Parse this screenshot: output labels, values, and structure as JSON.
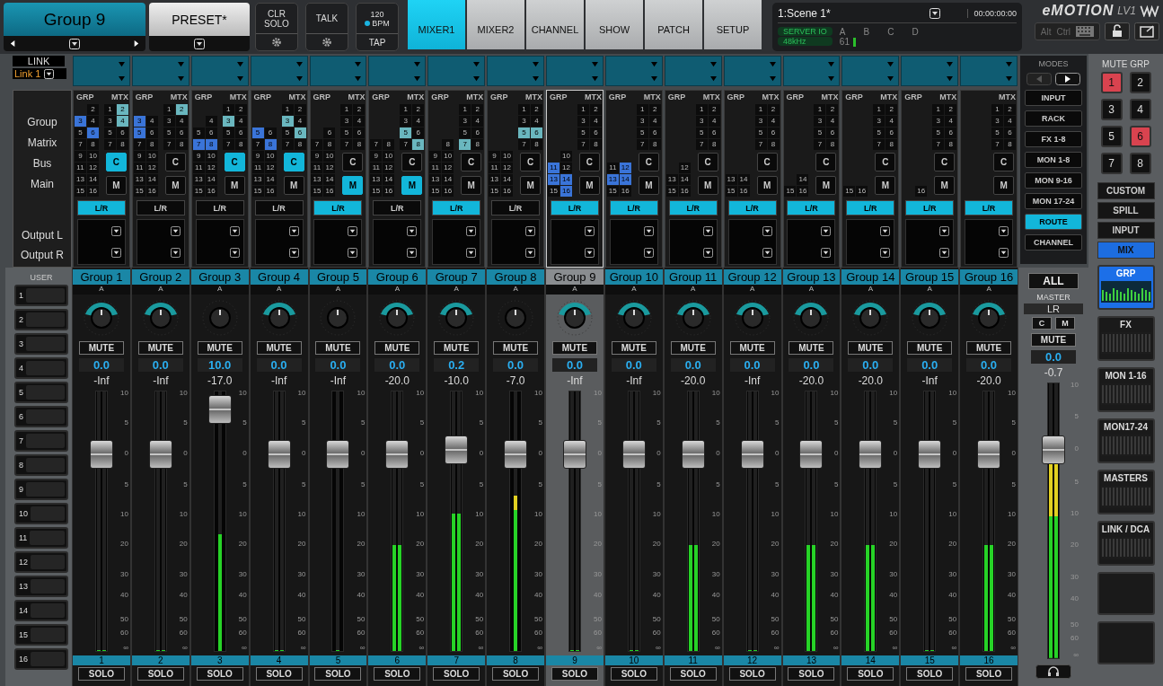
{
  "header": {
    "title": "Group 9",
    "preset": "PRESET*",
    "clr_solo": "CLR SOLO",
    "talk": "TALK",
    "bpm_value": "120",
    "bpm_label": "BPM",
    "tap": "TAP"
  },
  "tabs": [
    {
      "label": "MIXER1",
      "selected": true
    },
    {
      "label": "MIXER2",
      "selected": false
    },
    {
      "label": "CHANNEL",
      "selected": false
    },
    {
      "label": "SHOW",
      "selected": false
    },
    {
      "label": "PATCH",
      "selected": false
    },
    {
      "label": "SETUP",
      "selected": false
    }
  ],
  "scene": {
    "name": "1:Scene 1*",
    "timecode": "00:00:00:00",
    "server": "SERVER IO",
    "rate": "48kHz",
    "slots": [
      "A",
      "B",
      "C",
      "D"
    ],
    "reading": "61"
  },
  "logo": {
    "brand": "eMOTION",
    "model": "LV1"
  },
  "keys": [
    "Alt",
    "Ctrl"
  ],
  "link": {
    "title": "LINK",
    "value": "Link 1"
  },
  "route_labels": [
    "Group",
    "Matrix",
    "Bus",
    "Main",
    "Output L",
    "Output R"
  ],
  "user": {
    "title": "USER",
    "buttons": [
      "1",
      "2",
      "3",
      "4",
      "5",
      "6",
      "7",
      "8",
      "9",
      "10",
      "11",
      "12",
      "13",
      "14",
      "15",
      "16"
    ]
  },
  "channels": [
    {
      "name": "Group 1",
      "selected": false,
      "grp_header": "GRP",
      "mtx_header": "MTX",
      "grp": [
        {
          "label": "2",
          "selected": false
        },
        {
          "label": "3",
          "selected": true
        },
        {
          "label": "4",
          "selected": false
        },
        {
          "label": "5",
          "selected": false
        },
        {
          "label": "6",
          "selected": true
        },
        {
          "label": "7",
          "selected": false
        },
        {
          "label": "8",
          "selected": false
        },
        {
          "label": "9",
          "selected": false
        },
        {
          "label": "10",
          "selected": false
        },
        {
          "label": "11",
          "selected": false
        },
        {
          "label": "12",
          "selected": false
        },
        {
          "label": "13",
          "selected": false
        },
        {
          "label": "14",
          "selected": false
        },
        {
          "label": "15",
          "selected": false
        },
        {
          "label": "16",
          "selected": false
        }
      ],
      "mtx": [
        {
          "label": "1",
          "selected": false
        },
        {
          "label": "2",
          "selected": true
        },
        {
          "label": "3",
          "selected": false
        },
        {
          "label": "4",
          "selected": true
        },
        {
          "label": "5",
          "selected": false
        },
        {
          "label": "6",
          "selected": false
        },
        {
          "label": "7",
          "selected": false
        },
        {
          "label": "8",
          "selected": false
        }
      ],
      "c": {
        "label": "C",
        "on": true
      },
      "m": {
        "label": "M",
        "on": false
      },
      "lr": {
        "label": "L/R",
        "on": true
      },
      "insert": "A",
      "stereo": true,
      "mute": "MUTE",
      "value": "0.0",
      "reading": "-Inf",
      "scale": [
        "10",
        "5",
        "0",
        "5",
        "10",
        "20",
        "30",
        "40",
        "50",
        "60",
        "∞"
      ],
      "fader": {
        "level": 0.79
      },
      "meter": {
        "level": 0
      },
      "number": "1",
      "solo": "SOLO"
    },
    {
      "name": "Group 2",
      "selected": false,
      "grp_header": "GRP",
      "mtx_header": "MTX",
      "grp": [
        {
          "label": "3",
          "selected": true
        },
        {
          "label": "4",
          "selected": false
        },
        {
          "label": "5",
          "selected": true
        },
        {
          "label": "6",
          "selected": false
        },
        {
          "label": "7",
          "selected": false
        },
        {
          "label": "8",
          "selected": false
        },
        {
          "label": "9",
          "selected": false
        },
        {
          "label": "10",
          "selected": false
        },
        {
          "label": "11",
          "selected": false
        },
        {
          "label": "12",
          "selected": false
        },
        {
          "label": "13",
          "selected": false
        },
        {
          "label": "14",
          "selected": false
        },
        {
          "label": "15",
          "selected": false
        },
        {
          "label": "16",
          "selected": false
        }
      ],
      "mtx": [
        {
          "label": "1",
          "selected": false
        },
        {
          "label": "2",
          "selected": true
        },
        {
          "label": "3",
          "selected": false
        },
        {
          "label": "4",
          "selected": false
        },
        {
          "label": "5",
          "selected": false
        },
        {
          "label": "6",
          "selected": false
        },
        {
          "label": "7",
          "selected": false
        },
        {
          "label": "8",
          "selected": false
        }
      ],
      "c": {
        "label": "C",
        "on": false
      },
      "m": {
        "label": "M",
        "on": false
      },
      "lr": {
        "label": "L/R",
        "on": false
      },
      "insert": "A",
      "stereo": true,
      "mute": "MUTE",
      "value": "0.0",
      "reading": "-Inf",
      "scale": [
        "10",
        "5",
        "0",
        "5",
        "10",
        "20",
        "30",
        "40",
        "50",
        "60",
        "∞"
      ],
      "fader": {
        "level": 0.79
      },
      "meter": {
        "level": 0
      },
      "number": "2",
      "solo": "SOLO"
    },
    {
      "name": "Group 3",
      "selected": false,
      "grp_header": "GRP",
      "mtx_header": "MTX",
      "grp": [
        {
          "label": "4",
          "selected": false
        },
        {
          "label": "5",
          "selected": false
        },
        {
          "label": "6",
          "selected": false
        },
        {
          "label": "7",
          "selected": true
        },
        {
          "label": "8",
          "selected": true
        },
        {
          "label": "9",
          "selected": false
        },
        {
          "label": "10",
          "selected": false
        },
        {
          "label": "11",
          "selected": false
        },
        {
          "label": "12",
          "selected": false
        },
        {
          "label": "13",
          "selected": false
        },
        {
          "label": "14",
          "selected": false
        },
        {
          "label": "15",
          "selected": false
        },
        {
          "label": "16",
          "selected": false
        }
      ],
      "mtx": [
        {
          "label": "1",
          "selected": false
        },
        {
          "label": "2",
          "selected": false
        },
        {
          "label": "3",
          "selected": true
        },
        {
          "label": "4",
          "selected": false
        },
        {
          "label": "5",
          "selected": false
        },
        {
          "label": "6",
          "selected": false
        },
        {
          "label": "7",
          "selected": false
        },
        {
          "label": "8",
          "selected": false
        }
      ],
      "c": {
        "label": "C",
        "on": true
      },
      "m": {
        "label": "M",
        "on": false
      },
      "lr": {
        "label": "L/R",
        "on": false
      },
      "insert": "A",
      "stereo": false,
      "mute": "MUTE",
      "value": "10.0",
      "reading": "-17.0",
      "scale": [
        "10",
        "5",
        "0",
        "5",
        "10",
        "20",
        "30",
        "40",
        "50",
        "60",
        "∞"
      ],
      "fader": {
        "level": 0.98
      },
      "meter": {
        "level": 0.45
      },
      "number": "3",
      "solo": "SOLO"
    },
    {
      "name": "Group 4",
      "selected": false,
      "grp_header": "GRP",
      "mtx_header": "MTX",
      "grp": [
        {
          "label": "5",
          "selected": true
        },
        {
          "label": "6",
          "selected": false
        },
        {
          "label": "7",
          "selected": false
        },
        {
          "label": "8",
          "selected": true
        },
        {
          "label": "9",
          "selected": false
        },
        {
          "label": "10",
          "selected": false
        },
        {
          "label": "11",
          "selected": false
        },
        {
          "label": "12",
          "selected": false
        },
        {
          "label": "13",
          "selected": false
        },
        {
          "label": "14",
          "selected": false
        },
        {
          "label": "15",
          "selected": false
        },
        {
          "label": "16",
          "selected": false
        }
      ],
      "mtx": [
        {
          "label": "1",
          "selected": false
        },
        {
          "label": "2",
          "selected": false
        },
        {
          "label": "3",
          "selected": true
        },
        {
          "label": "4",
          "selected": false
        },
        {
          "label": "5",
          "selected": false
        },
        {
          "label": "6",
          "selected": true
        },
        {
          "label": "7",
          "selected": false
        },
        {
          "label": "8",
          "selected": false
        }
      ],
      "c": {
        "label": "C",
        "on": true
      },
      "m": {
        "label": "M",
        "on": false
      },
      "lr": {
        "label": "L/R",
        "on": false
      },
      "insert": "A",
      "stereo": true,
      "mute": "MUTE",
      "value": "0.0",
      "reading": "-Inf",
      "scale": [
        "10",
        "5",
        "0",
        "5",
        "10",
        "20",
        "30",
        "40",
        "50",
        "60",
        "∞"
      ],
      "fader": {
        "level": 0.79
      },
      "meter": {
        "level": 0
      },
      "number": "4",
      "solo": "SOLO"
    },
    {
      "name": "Group 5",
      "selected": false,
      "grp_header": "GRP",
      "mtx_header": "MTX",
      "grp": [
        {
          "label": "6",
          "selected": false
        },
        {
          "label": "7",
          "selected": false
        },
        {
          "label": "8",
          "selected": false
        },
        {
          "label": "9",
          "selected": false
        },
        {
          "label": "10",
          "selected": false
        },
        {
          "label": "11",
          "selected": false
        },
        {
          "label": "12",
          "selected": false
        },
        {
          "label": "13",
          "selected": false
        },
        {
          "label": "14",
          "selected": false
        },
        {
          "label": "15",
          "selected": false
        },
        {
          "label": "16",
          "selected": false
        }
      ],
      "mtx": [
        {
          "label": "1",
          "selected": false
        },
        {
          "label": "2",
          "selected": false
        },
        {
          "label": "3",
          "selected": false
        },
        {
          "label": "4",
          "selected": false
        },
        {
          "label": "5",
          "selected": false
        },
        {
          "label": "6",
          "selected": false
        },
        {
          "label": "7",
          "selected": false
        },
        {
          "label": "8",
          "selected": false
        }
      ],
      "c": {
        "label": "C",
        "on": false
      },
      "m": {
        "label": "M",
        "on": true
      },
      "lr": {
        "label": "L/R",
        "on": true
      },
      "insert": "A",
      "stereo": false,
      "mute": "MUTE",
      "value": "0.0",
      "reading": "-Inf",
      "scale": [
        "10",
        "5",
        "0",
        "5",
        "10",
        "20",
        "30",
        "40",
        "50",
        "60",
        "∞"
      ],
      "fader": {
        "level": 0.79
      },
      "meter": {
        "level": 0
      },
      "number": "5",
      "solo": "SOLO"
    },
    {
      "name": "Group 6",
      "selected": false,
      "grp_header": "GRP",
      "mtx_header": "MTX",
      "grp": [
        {
          "label": "7",
          "selected": false
        },
        {
          "label": "8",
          "selected": false
        },
        {
          "label": "9",
          "selected": false
        },
        {
          "label": "10",
          "selected": false
        },
        {
          "label": "11",
          "selected": false
        },
        {
          "label": "12",
          "selected": false
        },
        {
          "label": "13",
          "selected": false
        },
        {
          "label": "14",
          "selected": false
        },
        {
          "label": "15",
          "selected": false
        },
        {
          "label": "16",
          "selected": false
        }
      ],
      "mtx": [
        {
          "label": "1",
          "selected": false
        },
        {
          "label": "2",
          "selected": false
        },
        {
          "label": "3",
          "selected": false
        },
        {
          "label": "4",
          "selected": false
        },
        {
          "label": "5",
          "selected": true
        },
        {
          "label": "6",
          "selected": false
        },
        {
          "label": "7",
          "selected": false
        },
        {
          "label": "8",
          "selected": true
        }
      ],
      "c": {
        "label": "C",
        "on": false
      },
      "m": {
        "label": "M",
        "on": true
      },
      "lr": {
        "label": "L/R",
        "on": false
      },
      "insert": "A",
      "stereo": true,
      "mute": "MUTE",
      "value": "0.0",
      "reading": "-20.0",
      "scale": [
        "10",
        "5",
        "0",
        "5",
        "10",
        "20",
        "30",
        "40",
        "50",
        "60",
        "∞"
      ],
      "fader": {
        "level": 0.79
      },
      "meter": {
        "level": 0.41
      },
      "number": "6",
      "solo": "SOLO"
    },
    {
      "name": "Group 7",
      "selected": false,
      "grp_header": "GRP",
      "mtx_header": "MTX",
      "grp": [
        {
          "label": "8",
          "selected": false
        },
        {
          "label": "9",
          "selected": false
        },
        {
          "label": "10",
          "selected": false
        },
        {
          "label": "11",
          "selected": false
        },
        {
          "label": "12",
          "selected": false
        },
        {
          "label": "13",
          "selected": false
        },
        {
          "label": "14",
          "selected": false
        },
        {
          "label": "15",
          "selected": false
        },
        {
          "label": "16",
          "selected": false
        }
      ],
      "mtx": [
        {
          "label": "1",
          "selected": false
        },
        {
          "label": "2",
          "selected": false
        },
        {
          "label": "3",
          "selected": false
        },
        {
          "label": "4",
          "selected": false
        },
        {
          "label": "5",
          "selected": false
        },
        {
          "label": "6",
          "selected": false
        },
        {
          "label": "7",
          "selected": true
        },
        {
          "label": "8",
          "selected": false
        }
      ],
      "c": {
        "label": "C",
        "on": false
      },
      "m": {
        "label": "M",
        "on": false
      },
      "lr": {
        "label": "L/R",
        "on": true
      },
      "insert": "A",
      "stereo": true,
      "mute": "MUTE",
      "value": "0.2",
      "reading": "-10.0",
      "scale": [
        "10",
        "5",
        "0",
        "5",
        "10",
        "20",
        "30",
        "40",
        "50",
        "60",
        "∞"
      ],
      "fader": {
        "level": 0.81
      },
      "meter": {
        "level": 0.53
      },
      "number": "7",
      "solo": "SOLO"
    },
    {
      "name": "Group 8",
      "selected": false,
      "grp_header": "GRP",
      "mtx_header": "MTX",
      "grp": [
        {
          "label": "9",
          "selected": false
        },
        {
          "label": "10",
          "selected": false
        },
        {
          "label": "11",
          "selected": false
        },
        {
          "label": "12",
          "selected": false
        },
        {
          "label": "13",
          "selected": false
        },
        {
          "label": "14",
          "selected": false
        },
        {
          "label": "15",
          "selected": false
        },
        {
          "label": "16",
          "selected": false
        }
      ],
      "mtx": [
        {
          "label": "1",
          "selected": false
        },
        {
          "label": "2",
          "selected": false
        },
        {
          "label": "3",
          "selected": false
        },
        {
          "label": "4",
          "selected": false
        },
        {
          "label": "5",
          "selected": true
        },
        {
          "label": "6",
          "selected": true
        },
        {
          "label": "7",
          "selected": false
        },
        {
          "label": "8",
          "selected": false
        }
      ],
      "c": {
        "label": "C",
        "on": false
      },
      "m": {
        "label": "M",
        "on": false
      },
      "lr": {
        "label": "L/R",
        "on": false
      },
      "insert": "A",
      "stereo": false,
      "mute": "MUTE",
      "value": "0.0",
      "reading": "-7.0",
      "scale": [
        "10",
        "5",
        "0",
        "5",
        "10",
        "20",
        "30",
        "40",
        "50",
        "60",
        "∞"
      ],
      "fader": {
        "level": 0.79
      },
      "meter": {
        "level": 0.6
      },
      "number": "8",
      "solo": "SOLO"
    },
    {
      "name": "Group 9",
      "selected": true,
      "grp_header": "GRP",
      "mtx_header": "MTX",
      "grp": [
        {
          "label": "10",
          "selected": false
        },
        {
          "label": "11",
          "selected": true
        },
        {
          "label": "12",
          "selected": false
        },
        {
          "label": "13",
          "selected": true
        },
        {
          "label": "14",
          "selected": true
        },
        {
          "label": "15",
          "selected": false
        },
        {
          "label": "16",
          "selected": true
        }
      ],
      "mtx": [
        {
          "label": "1",
          "selected": false
        },
        {
          "label": "2",
          "selected": false
        },
        {
          "label": "3",
          "selected": false
        },
        {
          "label": "4",
          "selected": false
        },
        {
          "label": "5",
          "selected": false
        },
        {
          "label": "6",
          "selected": false
        },
        {
          "label": "7",
          "selected": false
        },
        {
          "label": "8",
          "selected": false
        }
      ],
      "c": {
        "label": "C",
        "on": false
      },
      "m": {
        "label": "M",
        "on": false
      },
      "lr": {
        "label": "L/R",
        "on": true
      },
      "insert": "A",
      "stereo": true,
      "mute": "MUTE",
      "value": "0.0",
      "reading": "-Inf",
      "scale": [
        "10",
        "5",
        "0",
        "5",
        "10",
        "20",
        "30",
        "40",
        "50",
        "60",
        "∞"
      ],
      "fader": {
        "level": 0.79
      },
      "meter": {
        "level": 0
      },
      "number": "9",
      "solo": "SOLO"
    },
    {
      "name": "Group 10",
      "selected": false,
      "grp_header": "GRP",
      "mtx_header": "MTX",
      "grp": [
        {
          "label": "11",
          "selected": false
        },
        {
          "label": "12",
          "selected": true
        },
        {
          "label": "13",
          "selected": true
        },
        {
          "label": "14",
          "selected": true
        },
        {
          "label": "15",
          "selected": false
        },
        {
          "label": "16",
          "selected": false
        }
      ],
      "mtx": [
        {
          "label": "1",
          "selected": false
        },
        {
          "label": "2",
          "selected": false
        },
        {
          "label": "3",
          "selected": false
        },
        {
          "label": "4",
          "selected": false
        },
        {
          "label": "5",
          "selected": false
        },
        {
          "label": "6",
          "selected": false
        },
        {
          "label": "7",
          "selected": false
        },
        {
          "label": "8",
          "selected": false
        }
      ],
      "c": {
        "label": "C",
        "on": false
      },
      "m": {
        "label": "M",
        "on": false
      },
      "lr": {
        "label": "L/R",
        "on": true
      },
      "insert": "A",
      "stereo": true,
      "mute": "MUTE",
      "value": "0.0",
      "reading": "-Inf",
      "scale": [
        "10",
        "5",
        "0",
        "5",
        "10",
        "20",
        "30",
        "40",
        "50",
        "60",
        "∞"
      ],
      "fader": {
        "level": 0.79
      },
      "meter": {
        "level": 0
      },
      "number": "10",
      "solo": "SOLO"
    },
    {
      "name": "Group 11",
      "selected": false,
      "grp_header": "GRP",
      "mtx_header": "MTX",
      "grp": [
        {
          "label": "12",
          "selected": false
        },
        {
          "label": "13",
          "selected": false
        },
        {
          "label": "14",
          "selected": false
        },
        {
          "label": "15",
          "selected": false
        },
        {
          "label": "16",
          "selected": false
        }
      ],
      "mtx": [
        {
          "label": "1",
          "selected": false
        },
        {
          "label": "2",
          "selected": false
        },
        {
          "label": "3",
          "selected": false
        },
        {
          "label": "4",
          "selected": false
        },
        {
          "label": "5",
          "selected": false
        },
        {
          "label": "6",
          "selected": false
        },
        {
          "label": "7",
          "selected": false
        },
        {
          "label": "8",
          "selected": false
        }
      ],
      "c": {
        "label": "C",
        "on": false
      },
      "m": {
        "label": "M",
        "on": false
      },
      "lr": {
        "label": "L/R",
        "on": true
      },
      "insert": "A",
      "stereo": true,
      "mute": "MUTE",
      "value": "0.0",
      "reading": "-20.0",
      "scale": [
        "10",
        "5",
        "0",
        "5",
        "10",
        "20",
        "30",
        "40",
        "50",
        "60",
        "∞"
      ],
      "fader": {
        "level": 0.79
      },
      "meter": {
        "level": 0.41
      },
      "number": "11",
      "solo": "SOLO"
    },
    {
      "name": "Group 12",
      "selected": false,
      "grp_header": "GRP",
      "mtx_header": "MTX",
      "grp": [
        {
          "label": "13",
          "selected": false
        },
        {
          "label": "14",
          "selected": false
        },
        {
          "label": "15",
          "selected": false
        },
        {
          "label": "16",
          "selected": false
        }
      ],
      "mtx": [
        {
          "label": "1",
          "selected": false
        },
        {
          "label": "2",
          "selected": false
        },
        {
          "label": "3",
          "selected": false
        },
        {
          "label": "4",
          "selected": false
        },
        {
          "label": "5",
          "selected": false
        },
        {
          "label": "6",
          "selected": false
        },
        {
          "label": "7",
          "selected": false
        },
        {
          "label": "8",
          "selected": false
        }
      ],
      "c": {
        "label": "C",
        "on": false
      },
      "m": {
        "label": "M",
        "on": false
      },
      "lr": {
        "label": "L/R",
        "on": true
      },
      "insert": "A",
      "stereo": true,
      "mute": "MUTE",
      "value": "0.0",
      "reading": "-Inf",
      "scale": [
        "10",
        "5",
        "0",
        "5",
        "10",
        "20",
        "30",
        "40",
        "50",
        "60",
        "∞"
      ],
      "fader": {
        "level": 0.79
      },
      "meter": {
        "level": 0
      },
      "number": "12",
      "solo": "SOLO"
    },
    {
      "name": "Group 13",
      "selected": false,
      "grp_header": "GRP",
      "mtx_header": "MTX",
      "grp": [
        {
          "label": "14",
          "selected": false
        },
        {
          "label": "15",
          "selected": false
        },
        {
          "label": "16",
          "selected": false
        }
      ],
      "mtx": [
        {
          "label": "1",
          "selected": false
        },
        {
          "label": "2",
          "selected": false
        },
        {
          "label": "3",
          "selected": false
        },
        {
          "label": "4",
          "selected": false
        },
        {
          "label": "5",
          "selected": false
        },
        {
          "label": "6",
          "selected": false
        },
        {
          "label": "7",
          "selected": false
        },
        {
          "label": "8",
          "selected": false
        }
      ],
      "c": {
        "label": "C",
        "on": false
      },
      "m": {
        "label": "M",
        "on": false
      },
      "lr": {
        "label": "L/R",
        "on": true
      },
      "insert": "A",
      "stereo": true,
      "mute": "MUTE",
      "value": "0.0",
      "reading": "-20.0",
      "scale": [
        "10",
        "5",
        "0",
        "5",
        "10",
        "20",
        "30",
        "40",
        "50",
        "60",
        "∞"
      ],
      "fader": {
        "level": 0.79
      },
      "meter": {
        "level": 0.41
      },
      "number": "13",
      "solo": "SOLO"
    },
    {
      "name": "Group 14",
      "selected": false,
      "grp_header": "GRP",
      "mtx_header": "MTX",
      "grp": [
        {
          "label": "15",
          "selected": false
        },
        {
          "label": "16",
          "selected": false
        }
      ],
      "mtx": [
        {
          "label": "1",
          "selected": false
        },
        {
          "label": "2",
          "selected": false
        },
        {
          "label": "3",
          "selected": false
        },
        {
          "label": "4",
          "selected": false
        },
        {
          "label": "5",
          "selected": false
        },
        {
          "label": "6",
          "selected": false
        },
        {
          "label": "7",
          "selected": false
        },
        {
          "label": "8",
          "selected": false
        }
      ],
      "c": {
        "label": "C",
        "on": false
      },
      "m": {
        "label": "M",
        "on": false
      },
      "lr": {
        "label": "L/R",
        "on": true
      },
      "insert": "A",
      "stereo": true,
      "mute": "MUTE",
      "value": "0.0",
      "reading": "-20.0",
      "scale": [
        "10",
        "5",
        "0",
        "5",
        "10",
        "20",
        "30",
        "40",
        "50",
        "60",
        "∞"
      ],
      "fader": {
        "level": 0.79
      },
      "meter": {
        "level": 0.41
      },
      "number": "14",
      "solo": "SOLO"
    },
    {
      "name": "Group 15",
      "selected": false,
      "grp_header": "GRP",
      "mtx_header": "MTX",
      "grp": [
        {
          "label": "16",
          "selected": false
        }
      ],
      "mtx": [
        {
          "label": "1",
          "selected": false
        },
        {
          "label": "2",
          "selected": false
        },
        {
          "label": "3",
          "selected": false
        },
        {
          "label": "4",
          "selected": false
        },
        {
          "label": "5",
          "selected": false
        },
        {
          "label": "6",
          "selected": false
        },
        {
          "label": "7",
          "selected": false
        },
        {
          "label": "8",
          "selected": false
        }
      ],
      "c": {
        "label": "C",
        "on": false
      },
      "m": {
        "label": "M",
        "on": false
      },
      "lr": {
        "label": "L/R",
        "on": true
      },
      "insert": "A",
      "stereo": true,
      "mute": "MUTE",
      "value": "0.0",
      "reading": "-Inf",
      "scale": [
        "10",
        "5",
        "0",
        "5",
        "10",
        "20",
        "30",
        "40",
        "50",
        "60",
        "∞"
      ],
      "fader": {
        "level": 0.79
      },
      "meter": {
        "level": 0
      },
      "number": "15",
      "solo": "SOLO"
    },
    {
      "name": "Group 16",
      "selected": false,
      "mtx_header": "MTX",
      "mtx": [
        {
          "label": "1",
          "selected": false
        },
        {
          "label": "2",
          "selected": false
        },
        {
          "label": "3",
          "selected": false
        },
        {
          "label": "4",
          "selected": false
        },
        {
          "label": "5",
          "selected": false
        },
        {
          "label": "6",
          "selected": false
        },
        {
          "label": "7",
          "selected": false
        },
        {
          "label": "8",
          "selected": false
        }
      ],
      "c": {
        "label": "C",
        "on": false
      },
      "m": {
        "label": "M",
        "on": false
      },
      "lr": {
        "label": "L/R",
        "on": true
      },
      "insert": "A",
      "stereo": true,
      "mute": "MUTE",
      "value": "0.0",
      "reading": "-20.0",
      "scale": [
        "10",
        "5",
        "0",
        "5",
        "10",
        "20",
        "30",
        "40",
        "50",
        "60",
        "∞"
      ],
      "fader": {
        "level": 0.79
      },
      "meter": {
        "level": 0.41
      },
      "number": "16",
      "solo": "SOLO"
    }
  ],
  "modes": {
    "title": "MODES",
    "items": [
      {
        "label": "INPUT",
        "selected": false
      },
      {
        "label": "RACK",
        "selected": false
      },
      {
        "label": "FX 1-8",
        "selected": false
      },
      {
        "label": "MON 1-8",
        "selected": false
      },
      {
        "label": "MON 9-16",
        "selected": false
      },
      {
        "label": "MON 17-24",
        "selected": false
      },
      {
        "label": "ROUTE",
        "selected": true
      },
      {
        "label": "CHANNEL",
        "selected": false
      }
    ]
  },
  "master": {
    "all": "ALL",
    "title": "MASTER",
    "bus": "LR",
    "c": "C",
    "m": "M",
    "mute": "MUTE",
    "value": "0.0",
    "reading": "-0.7",
    "scale": [
      "10",
      "5",
      "0",
      "5",
      "10",
      "20",
      "30",
      "40",
      "50",
      "60",
      "∞"
    ],
    "fader": {
      "level": 0.79
    },
    "meter": {
      "level": 0.8
    }
  },
  "mute_groups": {
    "title": "MUTE GRP",
    "items": [
      {
        "label": "1",
        "on": true
      },
      {
        "label": "2",
        "on": false
      },
      {
        "label": "3",
        "on": false
      },
      {
        "label": "4",
        "on": false
      },
      {
        "label": "5",
        "on": false
      },
      {
        "label": "6",
        "on": true
      },
      {
        "label": "7",
        "on": false
      },
      {
        "label": "8",
        "on": false
      }
    ]
  },
  "layers": [
    {
      "label": "CUSTOM",
      "selected": false
    },
    {
      "label": "SPILL",
      "selected": false
    },
    {
      "label": "INPUT",
      "selected": false
    },
    {
      "label": "MIX",
      "selected": true
    }
  ],
  "banks": [
    {
      "label": "GRP",
      "selected": true
    },
    {
      "label": "FX",
      "selected": false
    },
    {
      "label": "MON 1-16",
      "selected": false
    },
    {
      "label": "MON17-24",
      "selected": false
    },
    {
      "label": "MASTERS",
      "selected": false
    },
    {
      "label": "LINK / DCA",
      "selected": false
    }
  ]
}
